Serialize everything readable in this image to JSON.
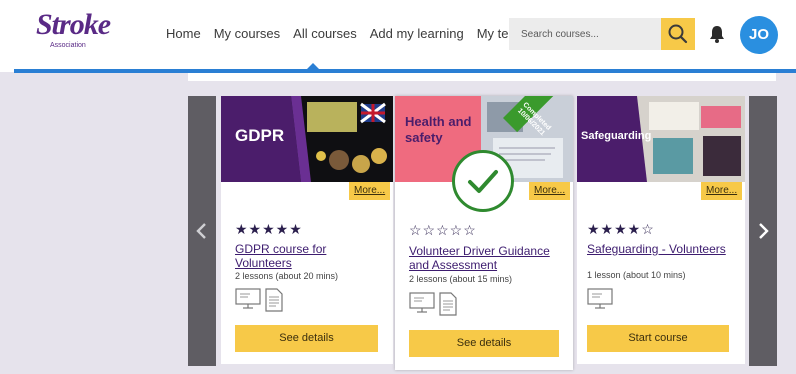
{
  "header": {
    "logo_text": "Stroke",
    "logo_subtext": "Association",
    "nav": [
      "Home",
      "My courses",
      "All courses",
      "Add my learning",
      "My team"
    ],
    "search_placeholder": "Search courses...",
    "avatar_initials": "JO"
  },
  "cards": [
    {
      "banner_title": "GDPR",
      "more_label": "More...",
      "rating": "★★★★★",
      "title": "GDPR course for Volunteers",
      "meta": "2 lessons (about 20 mins)",
      "cta": "See details"
    },
    {
      "banner_title": "Health and safety",
      "ribbon": "Completed 10/06/2021",
      "more_label": "More...",
      "rating": "☆☆☆☆☆",
      "title": "Volunteer Driver Guidance and Assessment",
      "meta": "2 lessons (about 15 mins)",
      "cta": "See details"
    },
    {
      "banner_title": "Safeguarding",
      "more_label": "More...",
      "rating": "★★★★☆",
      "title": "Safeguarding - Volunteers",
      "meta": "1 lesson (about 10 mins)",
      "cta": "Start course"
    }
  ],
  "colors": {
    "brand_purple": "#5a2a86",
    "accent_blue": "#2a7fd4",
    "button_yellow": "#f7c948",
    "completed_green": "#2f8a2f"
  }
}
